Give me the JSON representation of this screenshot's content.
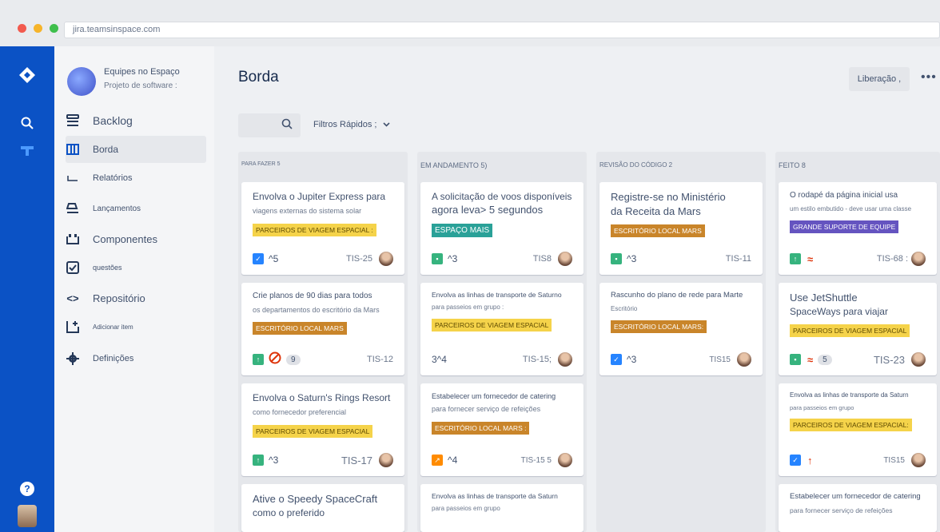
{
  "browser": {
    "url": "jira.teamsinspace.com",
    "dot_colors": [
      "#ff5f56",
      "#ffbd2e",
      "#27c93f"
    ]
  },
  "global_nav": {
    "help_label": "?"
  },
  "sidebar": {
    "project_name": "Equipes no Espaço",
    "project_type": "Projeto de software :",
    "items": [
      {
        "label": "Backlog",
        "icon": "backlog-icon"
      },
      {
        "label": "Borda",
        "icon": "board-icon"
      },
      {
        "label": "Relatórios",
        "icon": "reports-icon"
      },
      {
        "label": "Lançamentos",
        "icon": "releases-icon"
      },
      {
        "label": "Componentes",
        "icon": "components-icon"
      },
      {
        "label": "questões",
        "icon": "issues-icon"
      },
      {
        "label": "Repositório",
        "icon": "code-icon"
      },
      {
        "label": "Adicionar item",
        "icon": "add-item-icon"
      },
      {
        "label": "Definições",
        "icon": "gear-icon"
      }
    ]
  },
  "header": {
    "title": "Borda",
    "release_label": "Liberação ,",
    "more_label": "•••",
    "quick_filters_label": "Filtros Rápidos ;"
  },
  "columns": [
    {
      "title": "PARA FAZER 5",
      "cards": [
        {
          "title": "Envolva o Jupiter Express para",
          "sub": "viagens externas do sistema solar",
          "tag": "PARCEIROS DE VIAGEM ESPACIAL :",
          "type": "task",
          "est": "^5",
          "key": "TIS-25"
        },
        {
          "title": "Crie planos de 90 dias para todos",
          "sub": "os departamentos do escritório da Mars",
          "tag": "ESCRITÓRIO LOCAL MARS",
          "type": "story",
          "pts": "9",
          "key": "TIS-12"
        },
        {
          "title": "Envolva o Saturn's Rings Resort",
          "sub": "como fornecedor preferencial",
          "tag": "PARCEIROS DE VIAGEM ESPACIAL",
          "type": "story",
          "est": "^3",
          "key": "TIS-17"
        },
        {
          "title": "Ative o Speedy SpaceCraft",
          "sub": "como o preferido"
        }
      ]
    },
    {
      "title": "EM ANDAMENTO 5)",
      "cards": [
        {
          "title": "A solicitação de voos disponíveis",
          "sub": "agora leva> 5 segundos",
          "tag": "ESPAÇO MAIS",
          "type": "story",
          "est": "^3",
          "key": "TIS8"
        },
        {
          "title": "Envolva as linhas de transporte de Saturno",
          "sub": "para passeios em grupo :",
          "tag": "PARCEIROS DE VIAGEM ESPACIAL",
          "est": "3^4",
          "key": "TIS-15;"
        },
        {
          "title": "Estabelecer um fornecedor de catering",
          "sub": "para fornecer serviço de refeições",
          "tag": "ESCRITÓRIO LOCAL MARS :",
          "type": "bug",
          "est": "^4",
          "key": "TIS-15 5"
        },
        {
          "title": "Envolva as linhas de transporte da Saturn",
          "sub": "para passeios em grupo"
        }
      ]
    },
    {
      "title": "REVISÃO DO CÓDIGO 2",
      "cards": [
        {
          "title": "Registre-se no Ministério",
          "sub": "da Receita da Mars",
          "tag": "ESCRITÓRIO LOCAL MARS",
          "type": "story",
          "est": "^3",
          "key": "TIS-11"
        },
        {
          "title": "Rascunho do plano de rede para Marte",
          "sub": "Escritório",
          "tag": "ESCRITÓRIO LOCAL MARS:",
          "type": "task",
          "est": "^3",
          "key": "TIS15"
        }
      ]
    },
    {
      "title": "FEITO 8",
      "cards": [
        {
          "title": "O rodapé da página inicial usa",
          "sub": "um estilo embutido - deve usar uma classe",
          "tag": "GRANDE SUPORTE DE EQUIPE",
          "type": "story",
          "key": "TIS-68 :"
        },
        {
          "title": "Use JetShuttle",
          "sub": "SpaceWays para viajar",
          "tag": "PARCEIROS DE VIAGEM ESPACIAL",
          "type": "story",
          "pts": "5",
          "key": "TIS-23"
        },
        {
          "title": "Envolva as linhas de transporte da Saturn",
          "sub": "para passeios em grupo",
          "tag": "PARCEIROS DE VIAGEM ESPACIAL:",
          "type": "task",
          "key": "TIS15"
        },
        {
          "title": "Estabelecer um fornecedor de catering",
          "sub": "para fornecer serviço de refeições"
        }
      ]
    }
  ]
}
